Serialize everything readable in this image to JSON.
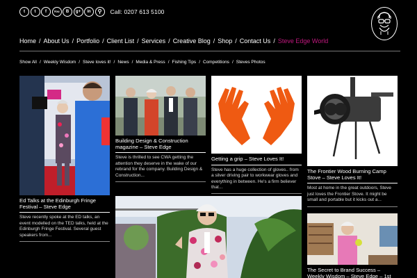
{
  "header": {
    "phone": "Call: 0207 613 5100",
    "social_icons": [
      {
        "name": "twitter-icon",
        "glyph": "t"
      },
      {
        "name": "twitter-alt-icon",
        "glyph": "t"
      },
      {
        "name": "facebook-icon",
        "glyph": "f"
      },
      {
        "name": "youtube-icon",
        "glyph": "You"
      },
      {
        "name": "blog-icon",
        "glyph": "B"
      },
      {
        "name": "google-plus-icon",
        "glyph": "g+"
      },
      {
        "name": "linkedin-icon",
        "glyph": "in"
      },
      {
        "name": "search-icon",
        "glyph": "⚲"
      }
    ]
  },
  "nav": {
    "items": [
      "Home",
      "About Us",
      "Portfolio",
      "Client List",
      "Services",
      "Creative Blog",
      "Shop",
      "Contact Us",
      "Steve Edge World"
    ],
    "active": "Steve Edge World",
    "accent": "#c2187f"
  },
  "subnav": {
    "items": [
      "Show All",
      "Weekly Wisdom",
      "Steve loves it!",
      "News",
      "Media & Press",
      "Fishing Tips",
      "Competitions",
      "Steves Photos"
    ]
  },
  "posts": [
    {
      "title": "Ed Talks at the Edinburgh Fringe Festival – Steve Edge",
      "excerpt": "Steve recently spoke at the ED talks, an event modelled on the TED talks, held at the Edinburgh Fringe Festival. Several guest speakers from..."
    },
    {
      "title": "Building Design & Construction magazine – Steve Edge",
      "excerpt": "Steve is thrilled to see CWA getting the attention they deserve in the wake of our rebrand for the company. Building Design & Construction..."
    },
    {
      "title": "Getting a grip – Steve Loves It!",
      "excerpt": "Steve has a huge collection of gloves.. from a silver driving pair to workwear gloves and everything in between. He's a firm believer that..."
    },
    {
      "title": "The Frontier Wood Burning Camp Stove – Steve Loves It!",
      "excerpt": "Most at home in the great outdoors, Steve just loves the Frontier Stove. It might be small and portable but it kicks out a..."
    },
    {
      "title": "",
      "excerpt": ""
    },
    {
      "title": "The Secret to Brand Success – Weekly Wisdom – Steve Edge – 1st",
      "excerpt": ""
    }
  ]
}
